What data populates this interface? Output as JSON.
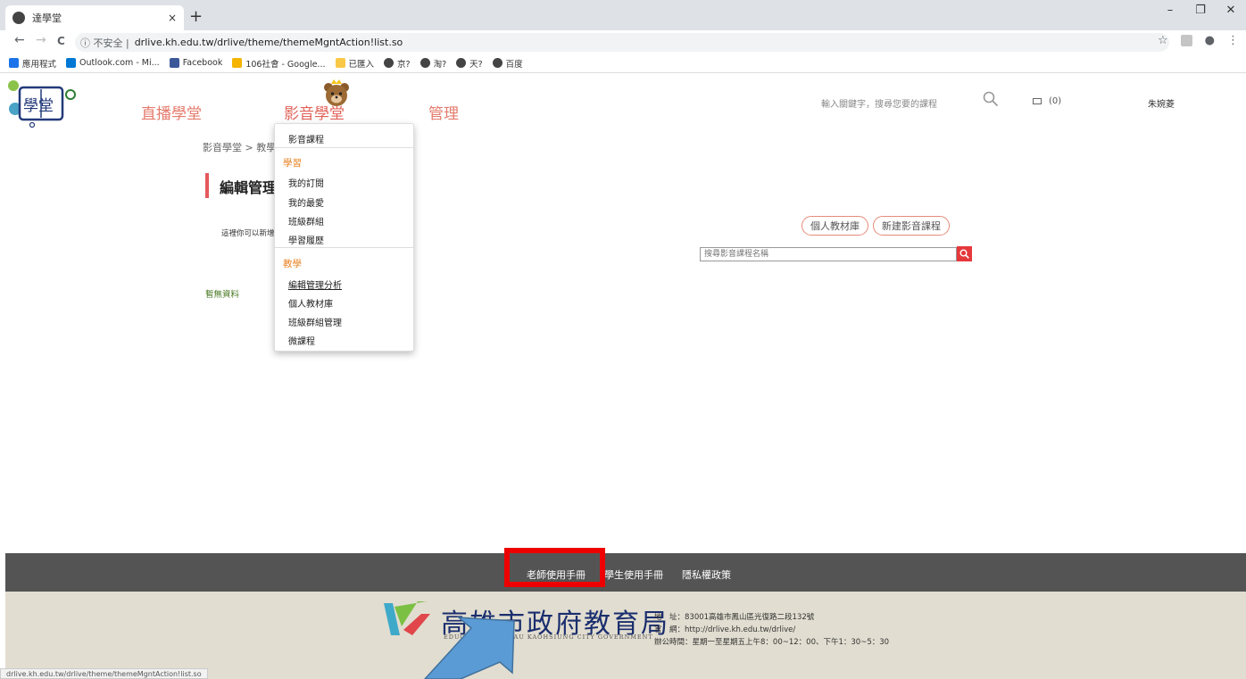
{
  "browser": {
    "tab_title": "達學堂",
    "tab_close": "×",
    "new_tab": "+",
    "window_controls": [
      "–",
      "❐",
      "✕"
    ],
    "nav": {
      "back": "←",
      "forward": "→",
      "reload": "C"
    },
    "security_label": "ⓘ 不安全 |",
    "url": "drlive.kh.edu.tw/drlive/theme/themeMgntAction!list.so",
    "bookmarks": [
      {
        "label": "應用程式",
        "icon": "apps-grid-icon",
        "color": "#1a73e8"
      },
      {
        "label": "Outlook.com - Mi...",
        "icon": "outlook-icon",
        "color": "#0078d4"
      },
      {
        "label": "Facebook",
        "icon": "facebook-icon",
        "color": "#3b5998"
      },
      {
        "label": "106社會 - Google...",
        "icon": "drive-icon",
        "color": "#f4b400"
      },
      {
        "label": "已匯入",
        "icon": "folder-icon",
        "color": "#f9c846"
      },
      {
        "label": "京?",
        "icon": "globe-icon",
        "color": "#444444"
      },
      {
        "label": "淘?",
        "icon": "globe-icon",
        "color": "#444444"
      },
      {
        "label": "天?",
        "icon": "globe-icon",
        "color": "#444444"
      },
      {
        "label": "百度",
        "icon": "globe-icon",
        "color": "#444444"
      }
    ]
  },
  "site": {
    "nav": [
      "直播學堂",
      "影音學堂",
      "管理"
    ],
    "search_hint": "輸入關鍵字，搜尋您要的課程",
    "mail_count": "(0)",
    "username": "朱婉菱"
  },
  "content": {
    "breadcrumb": "影音學堂 > 教學",
    "title": "編輯管理",
    "description": "這裡你可以新增",
    "no_data": "暫無資料",
    "buttons": [
      "個人教材庫",
      "新建影音課程"
    ],
    "search_placeholder": "搜尋影音課程名稱"
  },
  "dropdown": {
    "top_item": "影音課程",
    "learn_header": "學習",
    "learn_items": [
      "我的訂閱",
      "我的最愛",
      "班級群組",
      "學習履歷"
    ],
    "teach_header": "教學",
    "teach_items": [
      "編輯管理分析",
      "個人教材庫",
      "班級群組管理",
      "微課程"
    ]
  },
  "footer": {
    "links": [
      "老師使用手冊",
      "學生使用手冊",
      "隱私權政策"
    ],
    "bureau_name": "高雄市政府教育局",
    "bureau_en": "EDUCATION BUREAU KAOHSIUNG CITY GOVERNMENT",
    "address": "地　址：83001高雄市鳳山區光復路二段132號",
    "website": "官　網：http://drlive.kh.edu.tw/drlive/",
    "hours": "辦公時間：星期一至星期五上午8：00~12：00、下午1：30~5：30"
  },
  "status_url": "drlive.kh.edu.tw/drlive/theme/themeMgntAction!list.so",
  "colors": {
    "accent": "#e57b6c",
    "highlight_box": "#ee0000",
    "footer_dark": "#545454",
    "footer_light": "#e1ddd0"
  }
}
